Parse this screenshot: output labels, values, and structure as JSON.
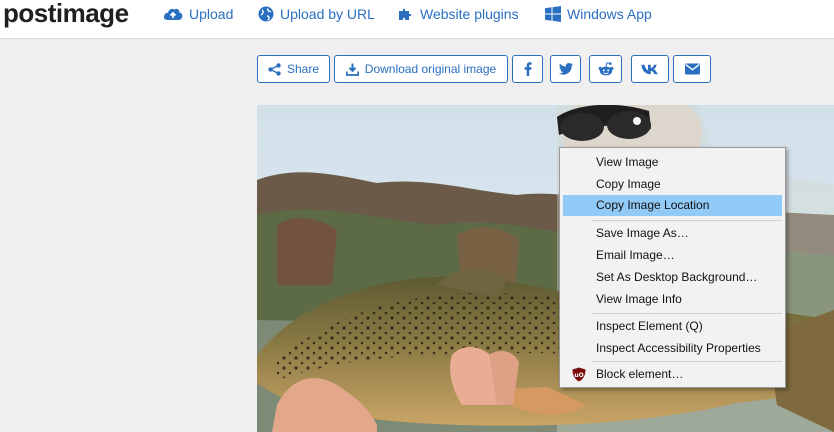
{
  "brand": {
    "logo_text": "postimage"
  },
  "nav": {
    "upload": "Upload",
    "upload_by_url": "Upload by URL",
    "website_plugins": "Website plugins",
    "windows_app": "Windows App"
  },
  "toolbar": {
    "share": "Share",
    "download": "Download original image",
    "social_icons": [
      "facebook-icon",
      "twitter-icon",
      "reddit-icon",
      "vk-icon",
      "email-icon"
    ]
  },
  "context_menu": {
    "items": [
      {
        "label": "View Image",
        "access_key": "I"
      },
      {
        "label": "Copy Image",
        "access_key": "y"
      },
      {
        "label": "Copy Image Location",
        "access_key": "o",
        "highlighted": true
      },
      {
        "label": "Save Image As…",
        "access_key": "v"
      },
      {
        "label": "Email Image…",
        "access_key": "g"
      },
      {
        "label": "Set As Desktop Background…",
        "access_key": "S"
      },
      {
        "label": "View Image Info",
        "access_key": "f"
      },
      {
        "label": "Inspect Element (Q)",
        "access_key": "Q"
      },
      {
        "label": "Inspect Accessibility Properties"
      },
      {
        "label": "Block element…",
        "icon": "ublock-origin-icon"
      }
    ]
  },
  "colors": {
    "accent": "#2a6fc0",
    "menu_highlight": "#91c9f7",
    "menu_background": "#f2f2f2",
    "page_background": "#efefef"
  }
}
